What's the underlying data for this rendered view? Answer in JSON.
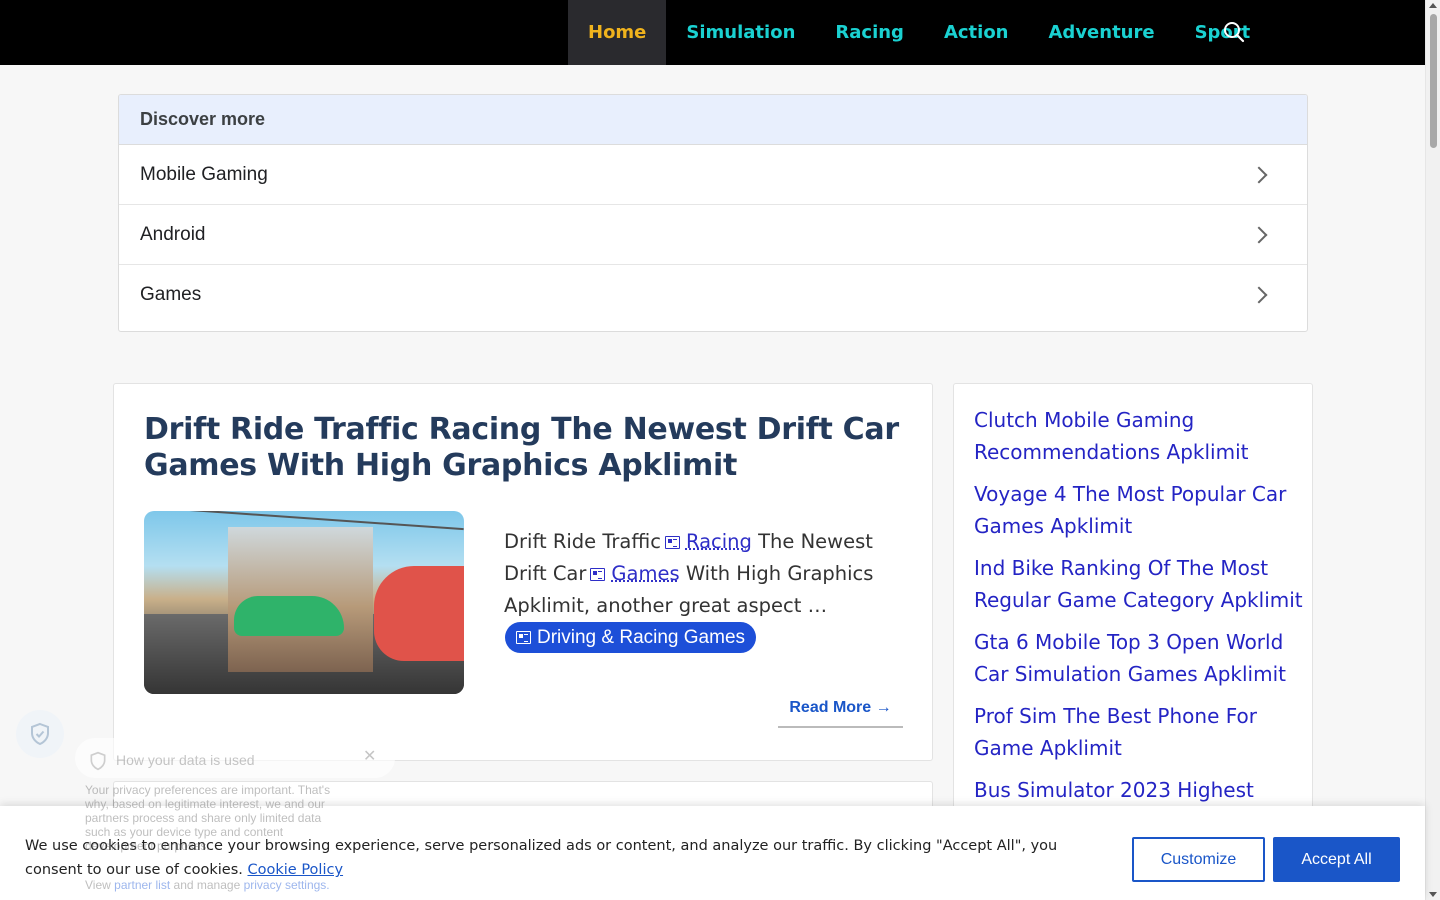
{
  "nav": {
    "items": [
      {
        "label": "Home",
        "active": true
      },
      {
        "label": "Simulation"
      },
      {
        "label": "Racing"
      },
      {
        "label": "Action"
      },
      {
        "label": "Adventure"
      },
      {
        "label": "Sport"
      }
    ],
    "search_icon": "search-icon",
    "colors": {
      "bg": "#000000",
      "link": "#1ad1d1",
      "active": "#f0b31d"
    }
  },
  "discover": {
    "title": "Discover more",
    "items": [
      "Mobile Gaming",
      "Android",
      "Games"
    ]
  },
  "article": {
    "title": "Drift Ride Traffic Racing The Newest Drift Car Games With High Graphics Apklimit",
    "excerpt_prefix": "Drift Ride Traffic",
    "link1": "Racing",
    "excerpt_mid": "The Newest Drift Car",
    "link2": "Games",
    "excerpt_suffix": "With High Graphics Apklimit, another great aspect …",
    "category": "Driving & Racing Games",
    "read_more": "Read More →"
  },
  "sidebar": {
    "links": [
      "Clutch Mobile Gaming Recommendations Apklimit",
      "Voyage 4 The Most Popular Car Games Apklimit",
      "Ind Bike Ranking Of The Most Regular Game Category Apklimit",
      "Gta 6 Mobile Top 3 Open World Car Simulation Games Apklimit",
      "Prof Sim The Best Phone For Game Apklimit",
      "Bus Simulator 2023 Highest"
    ]
  },
  "privacy": {
    "title": "How your data is used",
    "close": "✕",
    "body": "Your privacy preferences are important. That's why, based on legitimate interest, we and our partners process and share only limited data such as your device type and content development purposes.",
    "foot_prefix": "View",
    "partner_list": "partner list",
    "foot_mid": "and manage",
    "privacy_settings": "privacy settings."
  },
  "cookie": {
    "text": "We use cookies to enhance your browsing experience, serve personalized ads or content, and analyze our traffic. By clicking \"Accept All\", you consent to our use of cookies.",
    "policy_link": "Cookie Policy",
    "customize": "Customize",
    "accept": "Accept All"
  }
}
